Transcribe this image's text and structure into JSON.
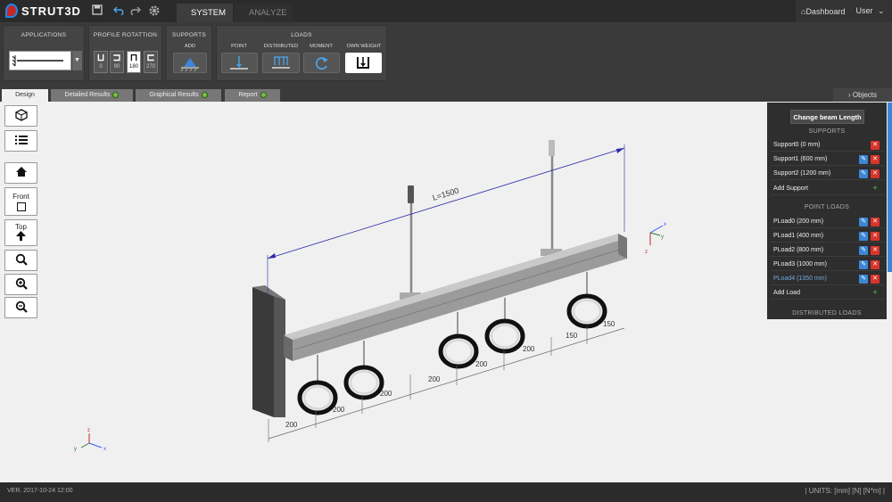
{
  "app": {
    "name": "STRUT3D"
  },
  "main_tabs": [
    {
      "label": "SYSTEM"
    },
    {
      "label": "ANALYZE"
    }
  ],
  "top_right": {
    "dashboard_label": "Dashboard",
    "user_label": "User"
  },
  "ribbon": {
    "applications": {
      "title": "APPLICATIONS"
    },
    "profile_rotation": {
      "title": "PROFILE ROTATTION",
      "options": [
        {
          "value": "0"
        },
        {
          "value": "90"
        },
        {
          "value": "180"
        },
        {
          "value": "270"
        }
      ],
      "selected": "180"
    },
    "supports": {
      "title": "SUPPORTS",
      "add_label": "ADD"
    },
    "loads": {
      "title": "LOADS",
      "point_label": "POINT",
      "distributed_label": "DISTRIBUTED",
      "moment_label": "MOMENT",
      "own_weight_label": "OWN WEIGHT"
    }
  },
  "sub_tabs": [
    {
      "label": "Design",
      "status": ""
    },
    {
      "label": "Detailed Results",
      "status": "ok"
    },
    {
      "label": "Graphical Results",
      "status": "ok"
    },
    {
      "label": "Report",
      "status": "ok"
    }
  ],
  "objects_button": {
    "label": "Objects"
  },
  "left_tools": {
    "front_label": "Front",
    "top_label": "Top"
  },
  "panel": {
    "change_beam_label": "Change beam Length",
    "supports_header": "SUPPORTS",
    "supports": [
      {
        "label": "Support0 (0 mm)",
        "editable": false
      },
      {
        "label": "Support1 (600 mm)",
        "editable": true
      },
      {
        "label": "Support2 (1200 mm)",
        "editable": true
      }
    ],
    "add_support_label": "Add Support",
    "point_loads_header": "POINT LOADS",
    "point_loads": [
      {
        "label": "PLoad0 (200 mm)"
      },
      {
        "label": "PLoad1 (400 mm)"
      },
      {
        "label": "PLoad2 (800 mm)"
      },
      {
        "label": "PLoad3 (1000 mm)"
      },
      {
        "label": "PLoad4 (1350 mm)"
      }
    ],
    "add_load_label": "Add Load",
    "distributed_loads_header": "DISTRIBUTED LOADS"
  },
  "viewport": {
    "length_label": "L=1500",
    "dimensions": [
      "200",
      "200",
      "200",
      "200",
      "200",
      "200",
      "150",
      "150"
    ],
    "axis_labels": {
      "x": "x",
      "y": "y",
      "z": "z"
    }
  },
  "status": {
    "version": "VER. 2017-10-24 12:00",
    "units": "| UNITS: [mm] [N] [N*m] |"
  },
  "colors": {
    "accent": "#3d86d6",
    "delete": "#d9342b",
    "status_ok": "#76c043",
    "dimension_line": "#2a2aa8"
  }
}
